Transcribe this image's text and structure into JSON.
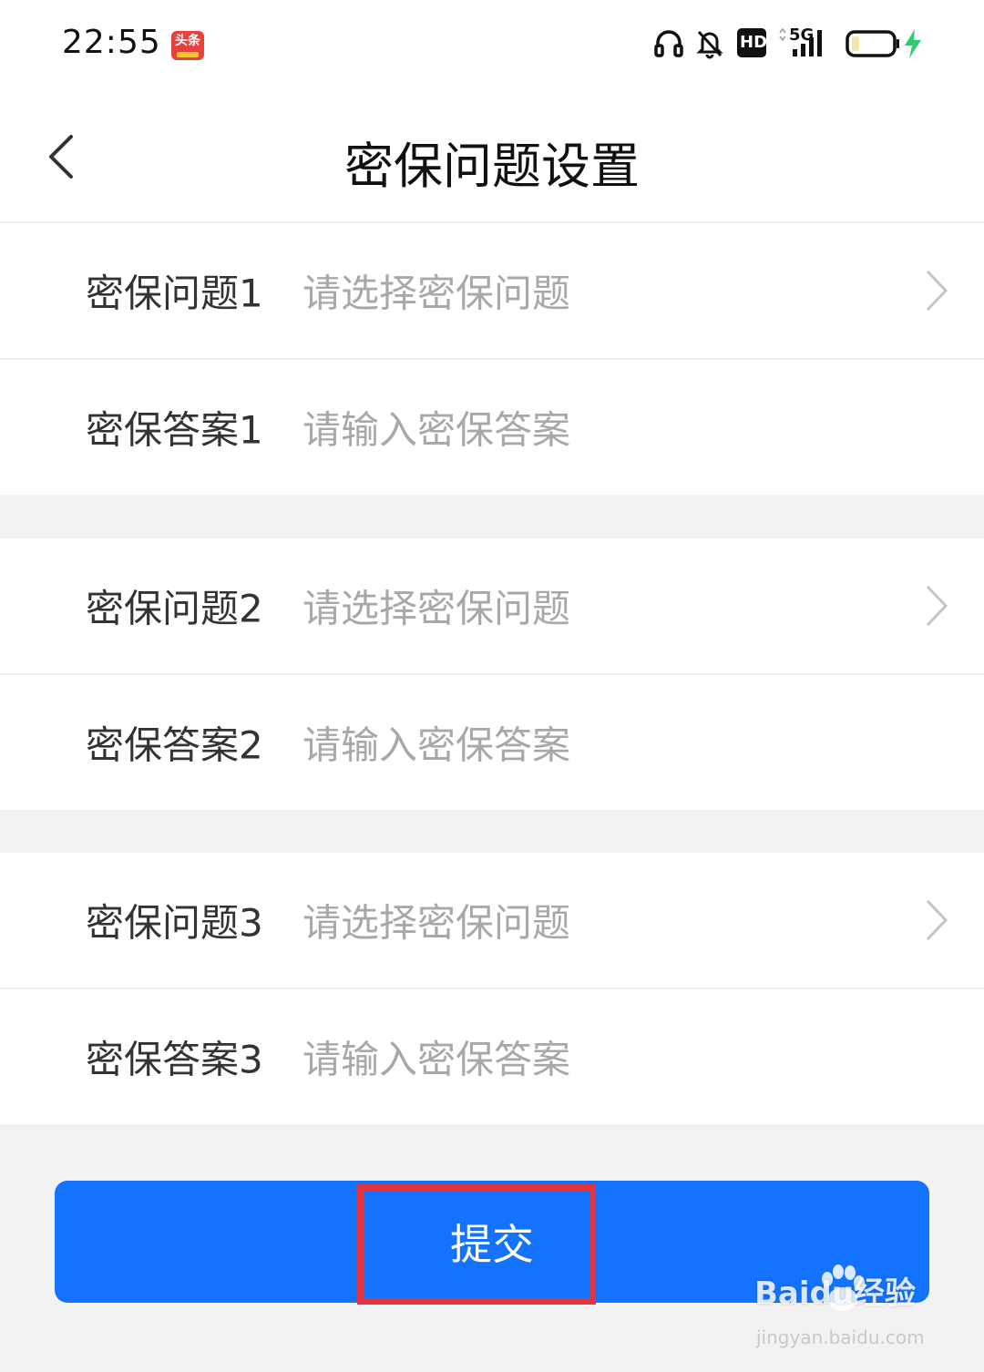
{
  "status_bar": {
    "time": "22:55",
    "app_badge": "头条",
    "network": "5G",
    "hd": "HD",
    "icons": [
      "headset-icon",
      "bell-mute-icon",
      "hd-icon",
      "signal-icon",
      "battery-icon",
      "charging-icon"
    ],
    "charging_color": "#2ecc71"
  },
  "header": {
    "title": "密保问题设置"
  },
  "rows": [
    {
      "label": "密保问题1",
      "placeholder": "请选择密保问题",
      "type": "select"
    },
    {
      "label": "密保答案1",
      "placeholder": "请输入密保答案",
      "type": "input"
    },
    {
      "label": "密保问题2",
      "placeholder": "请选择密保问题",
      "type": "select"
    },
    {
      "label": "密保答案2",
      "placeholder": "请输入密保答案",
      "type": "input"
    },
    {
      "label": "密保问题3",
      "placeholder": "请选择密保问题",
      "type": "select"
    },
    {
      "label": "密保答案3",
      "placeholder": "请输入密保答案",
      "type": "input"
    }
  ],
  "submit": {
    "label": "提交",
    "color": "#1373fe",
    "highlight_color": "#e2333f"
  },
  "watermark": {
    "text": "Baidu经验",
    "url": "jingyan.baidu.com"
  }
}
